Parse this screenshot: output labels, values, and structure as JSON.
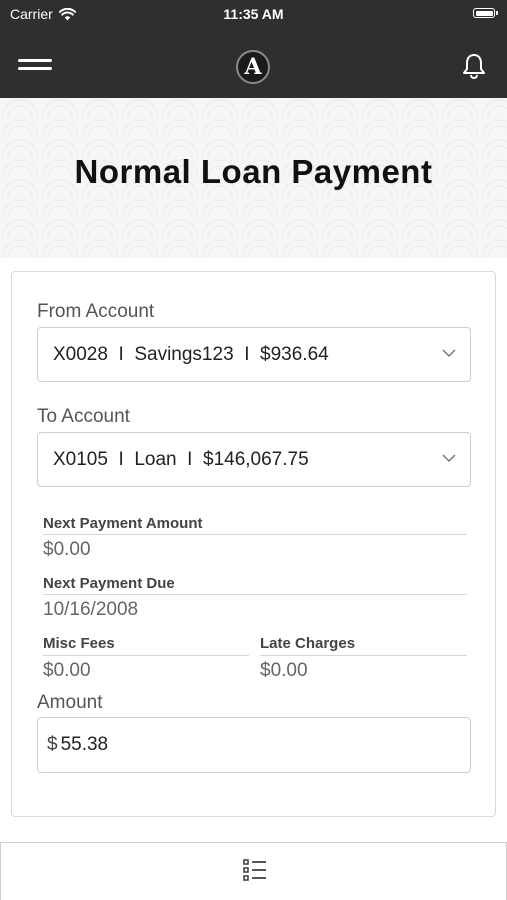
{
  "status_bar": {
    "carrier": "Carrier",
    "time": "11:35 AM",
    "icons": [
      "wifi-icon",
      "battery-icon"
    ]
  },
  "nav": {
    "logo_letter": "A",
    "icons": [
      "hamburger-menu-icon",
      "bell-icon"
    ]
  },
  "header": {
    "title": "Normal Loan Payment"
  },
  "form": {
    "from_account": {
      "label": "From Account",
      "value": "X0028  I  Savings123  I  $936.64"
    },
    "to_account": {
      "label": "To Account",
      "value": "X0105  I  Loan  I  $146,067.75"
    },
    "next_payment_amount": {
      "label": "Next Payment Amount",
      "value": "$0.00"
    },
    "next_payment_due": {
      "label": "Next Payment Due",
      "value": "10/16/2008"
    },
    "misc_fees": {
      "label": "Misc Fees",
      "value": "$0.00"
    },
    "late_charges": {
      "label": "Late Charges",
      "value": "$0.00"
    },
    "amount": {
      "label": "Amount",
      "currency": "$",
      "value": "55.38"
    }
  },
  "bottom_bar": {
    "icons": [
      "list-icon"
    ]
  },
  "colors": {
    "nav_background": "#2f2f2f",
    "header_background": "#f6f6f6",
    "border": "#cfcfcf"
  }
}
